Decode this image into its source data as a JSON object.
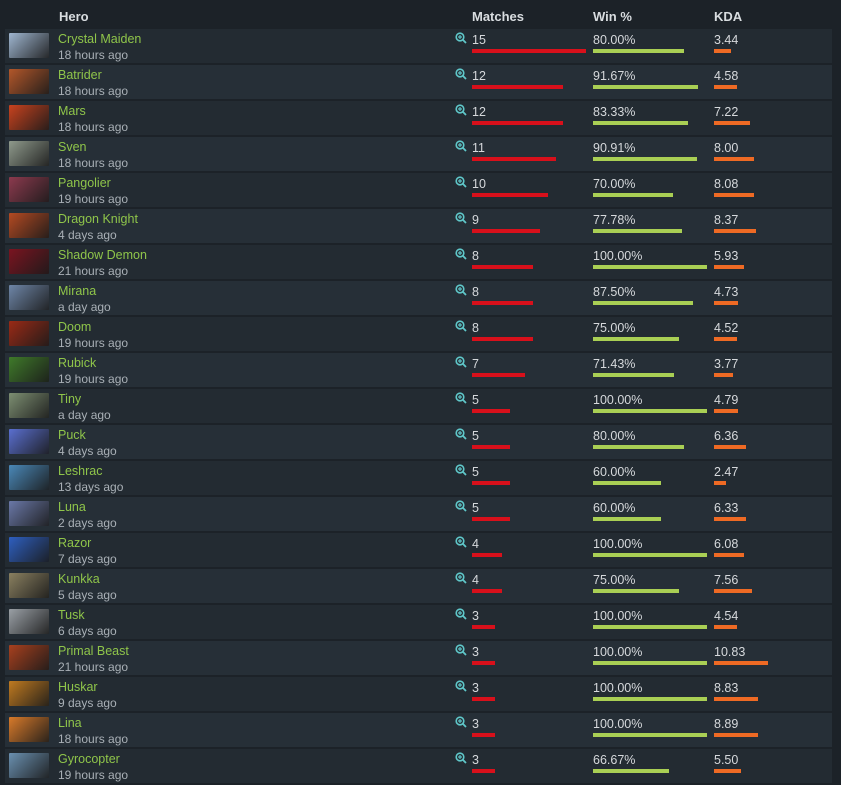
{
  "headers": {
    "hero": "Hero",
    "matches": "Matches",
    "win": "Win %",
    "kda": "KDA"
  },
  "colors": {
    "matches_bar": "#d8101b",
    "win_bar": "#a9cf54",
    "kda_bar": "#ee6a24",
    "hero_name": "#8fc54a"
  },
  "icons": {
    "row_action": "zoom-in-icon"
  },
  "rows": [
    {
      "hero": "Crystal Maiden",
      "ago": "18 hours ago",
      "matches": "15",
      "win": "80.00%",
      "kda": "3.44",
      "color": "#9fb6d0",
      "matches_frac": 1.0,
      "win_frac": 0.8,
      "kda_frac": 0.318
    },
    {
      "hero": "Batrider",
      "ago": "18 hours ago",
      "matches": "12",
      "win": "91.67%",
      "kda": "4.58",
      "color": "#b3572a",
      "matches_frac": 0.8,
      "win_frac": 0.9167,
      "kda_frac": 0.423
    },
    {
      "hero": "Mars",
      "ago": "18 hours ago",
      "matches": "12",
      "win": "83.33%",
      "kda": "7.22",
      "color": "#c8421e",
      "matches_frac": 0.8,
      "win_frac": 0.8333,
      "kda_frac": 0.667
    },
    {
      "hero": "Sven",
      "ago": "18 hours ago",
      "matches": "11",
      "win": "90.91%",
      "kda": "8.00",
      "color": "#8f9a8c",
      "matches_frac": 0.733,
      "win_frac": 0.9091,
      "kda_frac": 0.739
    },
    {
      "hero": "Pangolier",
      "ago": "19 hours ago",
      "matches": "10",
      "win": "70.00%",
      "kda": "8.08",
      "color": "#8c3a4e",
      "matches_frac": 0.667,
      "win_frac": 0.7,
      "kda_frac": 0.746
    },
    {
      "hero": "Dragon Knight",
      "ago": "4 days ago",
      "matches": "9",
      "win": "77.78%",
      "kda": "8.37",
      "color": "#b44a22",
      "matches_frac": 0.6,
      "win_frac": 0.7778,
      "kda_frac": 0.773
    },
    {
      "hero": "Shadow Demon",
      "ago": "21 hours ago",
      "matches": "8",
      "win": "100.00%",
      "kda": "5.93",
      "color": "#7a1420",
      "matches_frac": 0.533,
      "win_frac": 1.0,
      "kda_frac": 0.548
    },
    {
      "hero": "Mirana",
      "ago": "a day ago",
      "matches": "8",
      "win": "87.50%",
      "kda": "4.73",
      "color": "#6e86a8",
      "matches_frac": 0.533,
      "win_frac": 0.875,
      "kda_frac": 0.437
    },
    {
      "hero": "Doom",
      "ago": "19 hours ago",
      "matches": "8",
      "win": "75.00%",
      "kda": "4.52",
      "color": "#9a2a16",
      "matches_frac": 0.533,
      "win_frac": 0.75,
      "kda_frac": 0.417
    },
    {
      "hero": "Rubick",
      "ago": "19 hours ago",
      "matches": "7",
      "win": "71.43%",
      "kda": "3.77",
      "color": "#3f7a2a",
      "matches_frac": 0.467,
      "win_frac": 0.7143,
      "kda_frac": 0.348
    },
    {
      "hero": "Tiny",
      "ago": "a day ago",
      "matches": "5",
      "win": "100.00%",
      "kda": "4.79",
      "color": "#7d8f72",
      "matches_frac": 0.333,
      "win_frac": 1.0,
      "kda_frac": 0.442
    },
    {
      "hero": "Puck",
      "ago": "4 days ago",
      "matches": "5",
      "win": "80.00%",
      "kda": "6.36",
      "color": "#5a6fd0",
      "matches_frac": 0.333,
      "win_frac": 0.8,
      "kda_frac": 0.587
    },
    {
      "hero": "Leshrac",
      "ago": "13 days ago",
      "matches": "5",
      "win": "60.00%",
      "kda": "2.47",
      "color": "#4a88b8",
      "matches_frac": 0.333,
      "win_frac": 0.6,
      "kda_frac": 0.228
    },
    {
      "hero": "Luna",
      "ago": "2 days ago",
      "matches": "5",
      "win": "60.00%",
      "kda": "6.33",
      "color": "#6a78a8",
      "matches_frac": 0.333,
      "win_frac": 0.6,
      "kda_frac": 0.585
    },
    {
      "hero": "Razor",
      "ago": "7 days ago",
      "matches": "4",
      "win": "100.00%",
      "kda": "6.08",
      "color": "#2e5fc0",
      "matches_frac": 0.267,
      "win_frac": 1.0,
      "kda_frac": 0.561
    },
    {
      "hero": "Kunkka",
      "ago": "5 days ago",
      "matches": "4",
      "win": "75.00%",
      "kda": "7.56",
      "color": "#8a8060",
      "matches_frac": 0.267,
      "win_frac": 0.75,
      "kda_frac": 0.698
    },
    {
      "hero": "Tusk",
      "ago": "6 days ago",
      "matches": "3",
      "win": "100.00%",
      "kda": "4.54",
      "color": "#9aa0a6",
      "matches_frac": 0.2,
      "win_frac": 1.0,
      "kda_frac": 0.419
    },
    {
      "hero": "Primal Beast",
      "ago": "21 hours ago",
      "matches": "3",
      "win": "100.00%",
      "kda": "10.83",
      "color": "#a8401e",
      "matches_frac": 0.2,
      "win_frac": 1.0,
      "kda_frac": 1.0
    },
    {
      "hero": "Huskar",
      "ago": "9 days ago",
      "matches": "3",
      "win": "100.00%",
      "kda": "8.83",
      "color": "#c07a20",
      "matches_frac": 0.2,
      "win_frac": 1.0,
      "kda_frac": 0.815
    },
    {
      "hero": "Lina",
      "ago": "18 hours ago",
      "matches": "3",
      "win": "100.00%",
      "kda": "8.89",
      "color": "#d87a2a",
      "matches_frac": 0.2,
      "win_frac": 1.0,
      "kda_frac": 0.821
    },
    {
      "hero": "Gyrocopter",
      "ago": "19 hours ago",
      "matches": "3",
      "win": "66.67%",
      "kda": "5.50",
      "color": "#6a90b0",
      "matches_frac": 0.2,
      "win_frac": 0.6667,
      "kda_frac": 0.508
    }
  ]
}
